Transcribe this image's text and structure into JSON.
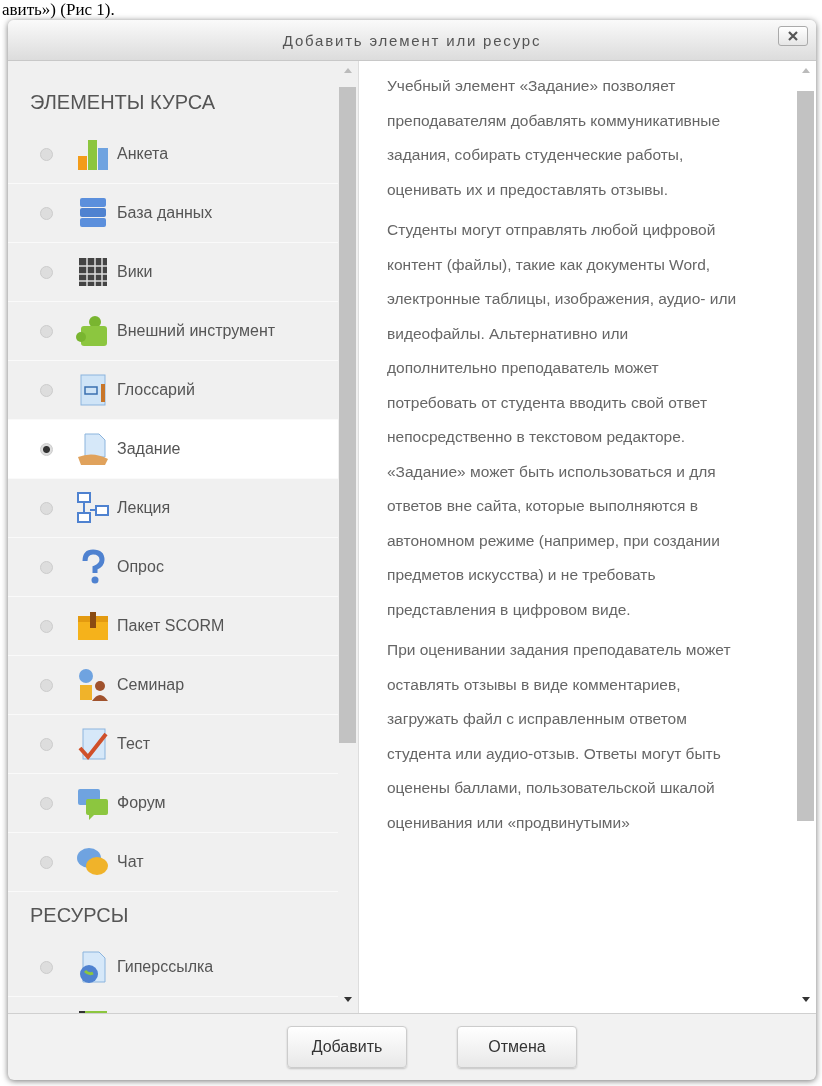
{
  "document_fragment": "авить») (Рис 1).",
  "dialog": {
    "title": "Добавить элемент или ресурс",
    "sections": [
      {
        "heading": "ЭЛЕМЕНТЫ КУРСА",
        "items": [
          {
            "label": "Анкета",
            "kind": "survey",
            "selected": false
          },
          {
            "label": "База данных",
            "kind": "database",
            "selected": false
          },
          {
            "label": "Вики",
            "kind": "wiki",
            "selected": false
          },
          {
            "label": "Внешний инструмент",
            "kind": "puzzle",
            "selected": false
          },
          {
            "label": "Глоссарий",
            "kind": "glossary",
            "selected": false
          },
          {
            "label": "Задание",
            "kind": "assignment",
            "selected": true
          },
          {
            "label": "Лекция",
            "kind": "lesson",
            "selected": false
          },
          {
            "label": "Опрос",
            "kind": "question",
            "selected": false
          },
          {
            "label": "Пакет SCORM",
            "kind": "package",
            "selected": false
          },
          {
            "label": "Семинар",
            "kind": "workshop",
            "selected": false
          },
          {
            "label": "Тест",
            "kind": "quiz",
            "selected": false
          },
          {
            "label": "Форум",
            "kind": "forum",
            "selected": false
          },
          {
            "label": "Чат",
            "kind": "chat",
            "selected": false
          }
        ]
      },
      {
        "heading": "РЕСУРСЫ",
        "items": [
          {
            "label": "Гиперссылка",
            "kind": "url",
            "selected": false
          },
          {
            "kind": "book"
          }
        ]
      }
    ],
    "description": [
      "Учебный элемент «Задание» позволяет преподавателям добавлять коммуникативные задания, собирать студенческие работы, оценивать их и предоставлять отзывы.",
      "Студенты могут отправлять любой цифровой контент (файлы), такие как документы Word, электронные таблицы, изображения, аудио- или видеофайлы. Альтернативно или дополнительно преподаватель может потребовать от студента вводить свой ответ непосредственно в текстовом редакторе. «Задание» может быть использоваться и для ответов вне сайта, которые выполняются в автономном режиме (например, при создании предметов искусства) и не требовать представления в цифровом виде.",
      "При оценивании задания преподаватель может оставлять отзывы в виде комментариев, загружать файл с исправленным ответом студента или аудио-отзыв. Ответы могут быть оценены баллами, пользовательской шкалой оценивания или «продвинутыми»"
    ],
    "buttons": [
      "Добавить",
      "Отмена"
    ]
  }
}
